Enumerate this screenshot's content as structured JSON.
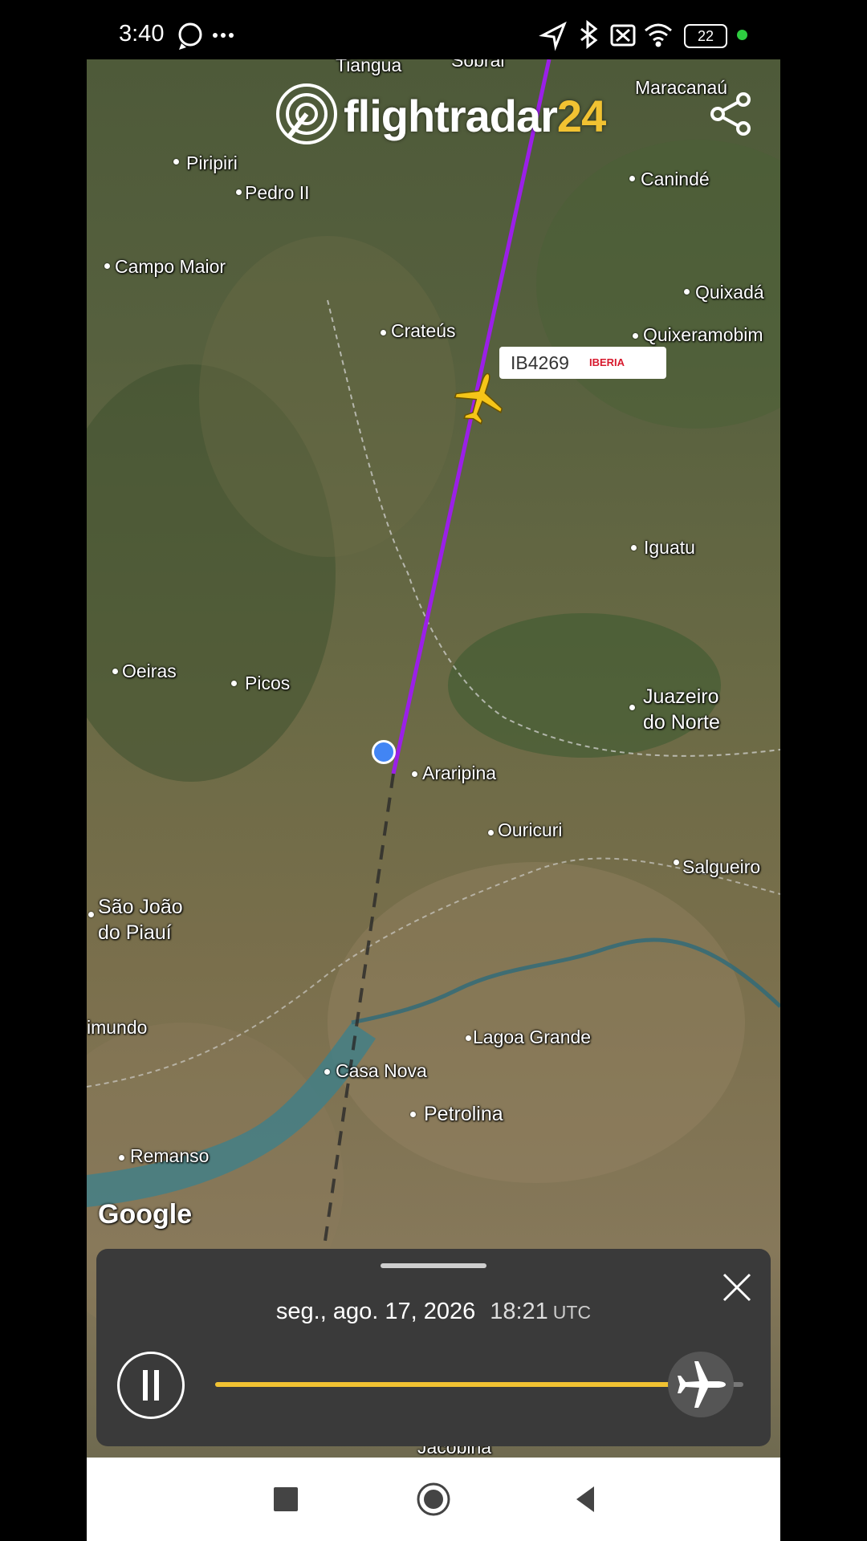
{
  "status_bar": {
    "time": "3:40",
    "dots": "···",
    "battery": "22"
  },
  "app": {
    "logo_text": "flightradar",
    "logo_accent": "24"
  },
  "map": {
    "cities": [
      {
        "name": "Tiangua"
      },
      {
        "name": "Maracanaú"
      },
      {
        "name": "Piripiri"
      },
      {
        "name": "Pedro II"
      },
      {
        "name": "Canindé"
      },
      {
        "name": "Campo Maior"
      },
      {
        "name": "Quixadá"
      },
      {
        "name": "Crateús"
      },
      {
        "name": "Quixeramobim"
      },
      {
        "name": "Iguatu"
      },
      {
        "name": "Oeiras"
      },
      {
        "name": "Picos"
      },
      {
        "name": "Juazeiro\ndo Norte"
      },
      {
        "name": "Araripina"
      },
      {
        "name": "Ouricuri"
      },
      {
        "name": "Salgueiro"
      },
      {
        "name": "São João\ndo Piauí"
      },
      {
        "name": "imundo"
      },
      {
        "name": "Lagoa Grande"
      },
      {
        "name": "Casa Nova"
      },
      {
        "name": "Petrolina"
      },
      {
        "name": "Remanso"
      },
      {
        "name": "Sobral"
      },
      {
        "name": "Jacobina"
      }
    ],
    "flight": {
      "code": "IB4269",
      "airline": "IBERIA"
    },
    "attribution": "Google"
  },
  "playback": {
    "date": "seg., ago. 17, 2026",
    "time": "18:21",
    "timezone": "UTC",
    "progress": 0.92
  },
  "colors": {
    "track": "#9b1fe8",
    "accent": "#f1c232",
    "plane": "#f5c518"
  }
}
